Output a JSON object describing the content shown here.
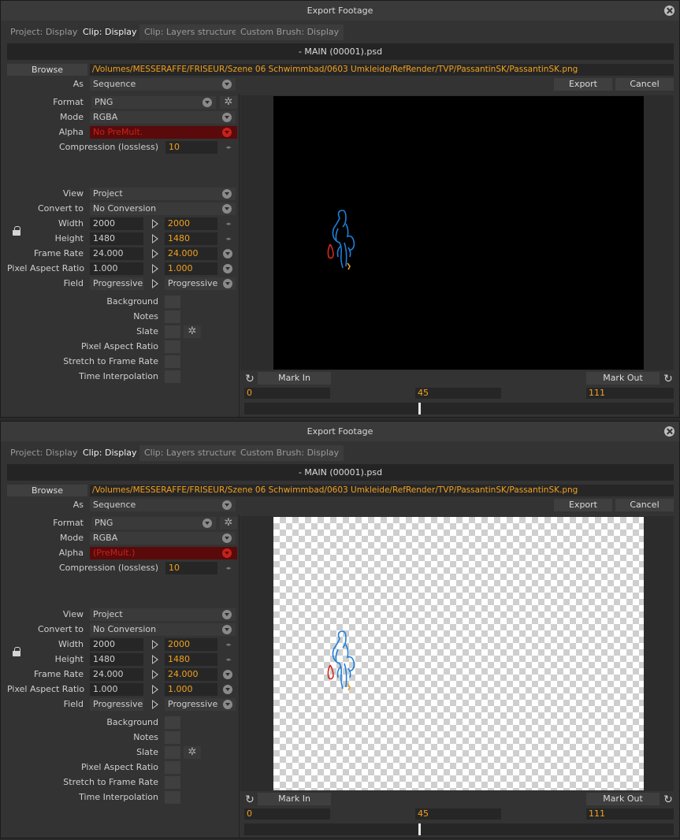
{
  "windows": [
    {
      "id": "win-1",
      "title": "Export Footage",
      "tabs": [
        "Project: Display",
        "Clip: Display",
        "Clip: Layers structure",
        "Custom Brush: Display"
      ],
      "active_tab": "Clip: Display",
      "subtitle": "- MAIN (00001).psd",
      "browse_label": "Browse",
      "path": "/Volumes/MESSERAFFE/FRISEUR/Szene 06 Schwimmbad/0603 Umkleide/RefRender/TVP/PassantinSK/PassantinSK.png",
      "as_label": "As",
      "as_value": "Sequence",
      "export_label": "Export",
      "cancel_label": "Cancel",
      "format_label": "Format",
      "format_value": "PNG",
      "mode_label": "Mode",
      "mode_value": "RGBA",
      "alpha_label": "Alpha",
      "alpha_value": "No PreMult.",
      "compression_label": "Compression (lossless)",
      "compression_value": "10",
      "view_label": "View",
      "view_value": "Project",
      "convert_label": "Convert to",
      "convert_value": "No Conversion",
      "width_label": "Width",
      "width_src": "2000",
      "width_dst": "2000",
      "height_label": "Height",
      "height_src": "1480",
      "height_dst": "1480",
      "framerate_label": "Frame Rate",
      "framerate_src": "24.000",
      "framerate_dst": "24.000",
      "par_label": "Pixel Aspect Ratio",
      "par_src": "1.000",
      "par_dst": "1.000",
      "field_label": "Field",
      "field_src": "Progressive",
      "field_dst": "Progressive",
      "checks": [
        "Background",
        "Notes",
        "Slate",
        "Pixel Aspect Ratio",
        "Stretch to Frame Rate",
        "Time Interpolation"
      ],
      "mark_in_label": "Mark In",
      "mark_out_label": "Mark Out",
      "time_start": "0",
      "time_current": "45",
      "time_end": "111",
      "preview_background": "black"
    },
    {
      "id": "win-2",
      "title": "Export Footage",
      "tabs": [
        "Project: Display",
        "Clip: Display",
        "Clip: Layers structure",
        "Custom Brush: Display"
      ],
      "active_tab": "Clip: Display",
      "subtitle": "- MAIN (00001).psd",
      "browse_label": "Browse",
      "path": "/Volumes/MESSERAFFE/FRISEUR/Szene 06 Schwimmbad/0603 Umkleide/RefRender/TVP/PassantinSK/PassantinSK.png",
      "as_label": "As",
      "as_value": "Sequence",
      "export_label": "Export",
      "cancel_label": "Cancel",
      "format_label": "Format",
      "format_value": "PNG",
      "mode_label": "Mode",
      "mode_value": "RGBA",
      "alpha_label": "Alpha",
      "alpha_value": "(PreMult.)",
      "compression_label": "Compression (lossless)",
      "compression_value": "10",
      "view_label": "View",
      "view_value": "Project",
      "convert_label": "Convert to",
      "convert_value": "No Conversion",
      "width_label": "Width",
      "width_src": "2000",
      "width_dst": "2000",
      "height_label": "Height",
      "height_src": "1480",
      "height_dst": "1480",
      "framerate_label": "Frame Rate",
      "framerate_src": "24.000",
      "framerate_dst": "24.000",
      "par_label": "Pixel Aspect Ratio",
      "par_src": "1.000",
      "par_dst": "1.000",
      "field_label": "Field",
      "field_src": "Progressive",
      "field_dst": "Progressive",
      "checks": [
        "Background",
        "Notes",
        "Slate",
        "Pixel Aspect Ratio",
        "Stretch to Frame Rate",
        "Time Interpolation"
      ],
      "mark_in_label": "Mark In",
      "mark_out_label": "Mark Out",
      "time_start": "0",
      "time_current": "45",
      "time_end": "111",
      "preview_background": "checkerboard"
    }
  ],
  "colors": {
    "accent_orange": "#f3a11e",
    "alpha_red": "#c5221d",
    "alpha_bg": "#5a0a0a",
    "figure_blue": "#1e7fd8",
    "figure_red": "#d02a1f"
  },
  "timeline": {
    "current_fraction": 0.405
  }
}
